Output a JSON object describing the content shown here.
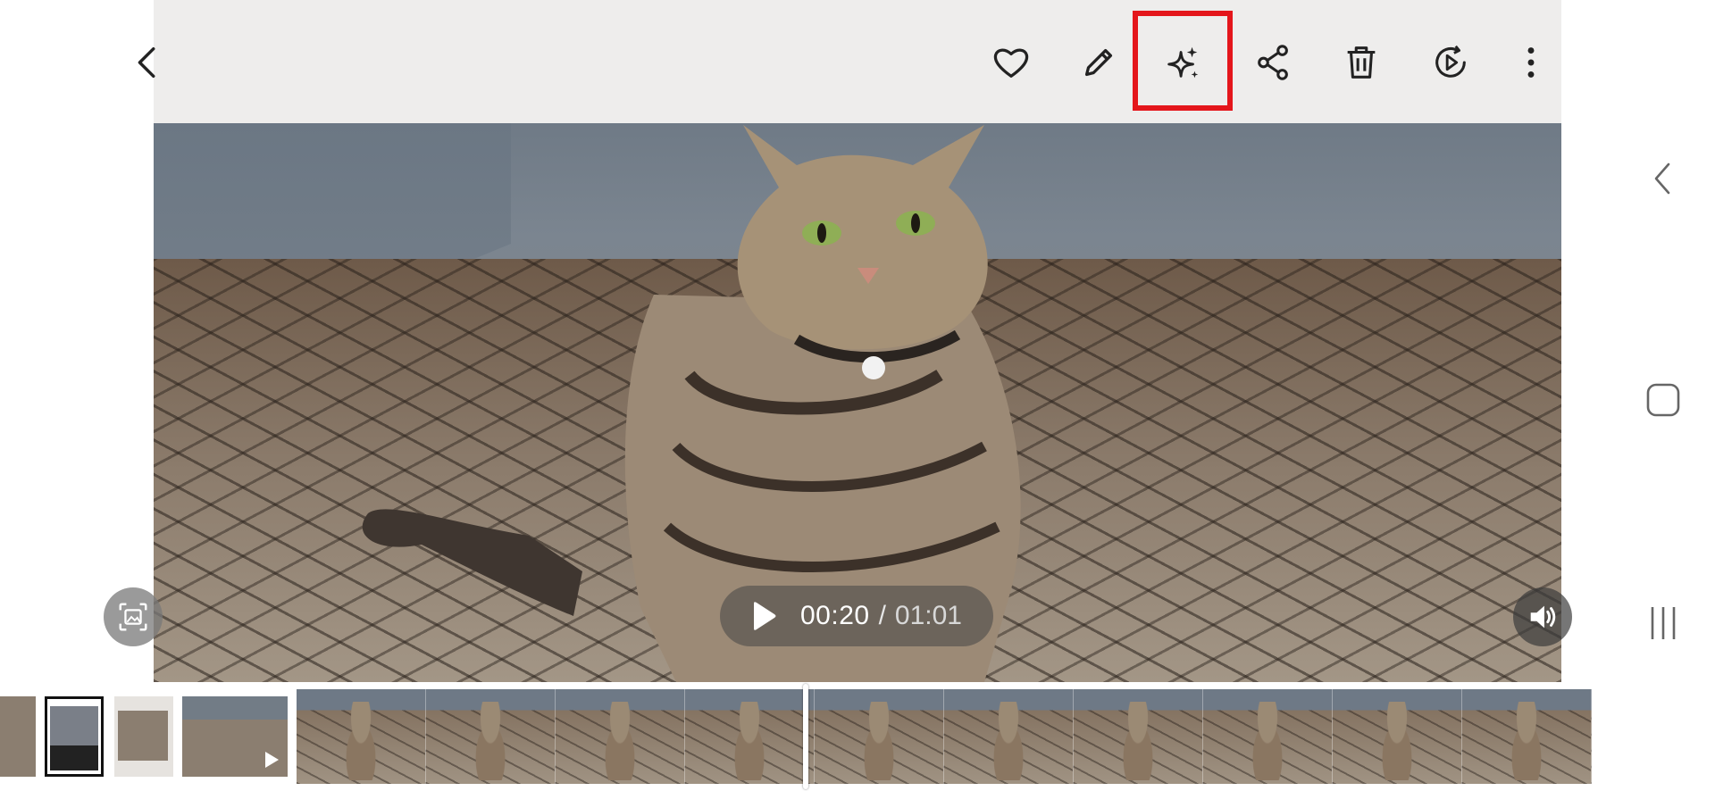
{
  "player": {
    "current_time": "00:20",
    "separator": "/",
    "duration": "01:01"
  },
  "toolbar": {
    "icons": [
      "chevron-left-icon",
      "heart-icon",
      "pencil-icon",
      "sparkles-icon",
      "share-icon",
      "trash-icon",
      "play-circle-icon",
      "more-vert-icon"
    ],
    "highlight_color": "#e4161b"
  },
  "nav": {
    "icons": [
      "back-icon",
      "home-icon",
      "recents-icon"
    ]
  },
  "filmstrip": {
    "thumbnails": 4,
    "frames": 10
  }
}
